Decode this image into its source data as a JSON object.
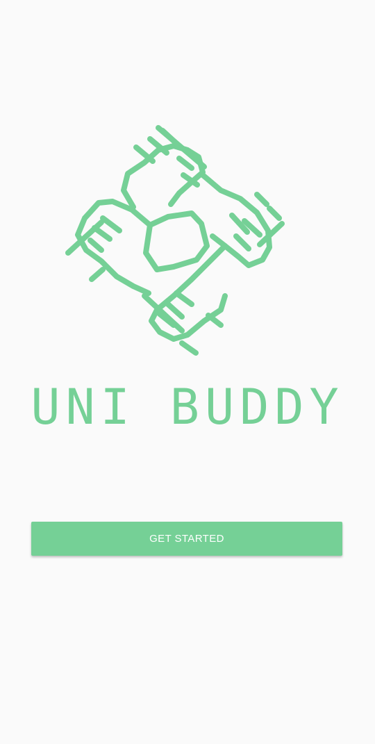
{
  "brand": {
    "title": "UNI BUDDY",
    "logo_icon": "helping-hands-icon",
    "accent_color": "#75d096",
    "background_color": "#fafafa"
  },
  "actions": {
    "get_started_label": "GET STARTED"
  }
}
